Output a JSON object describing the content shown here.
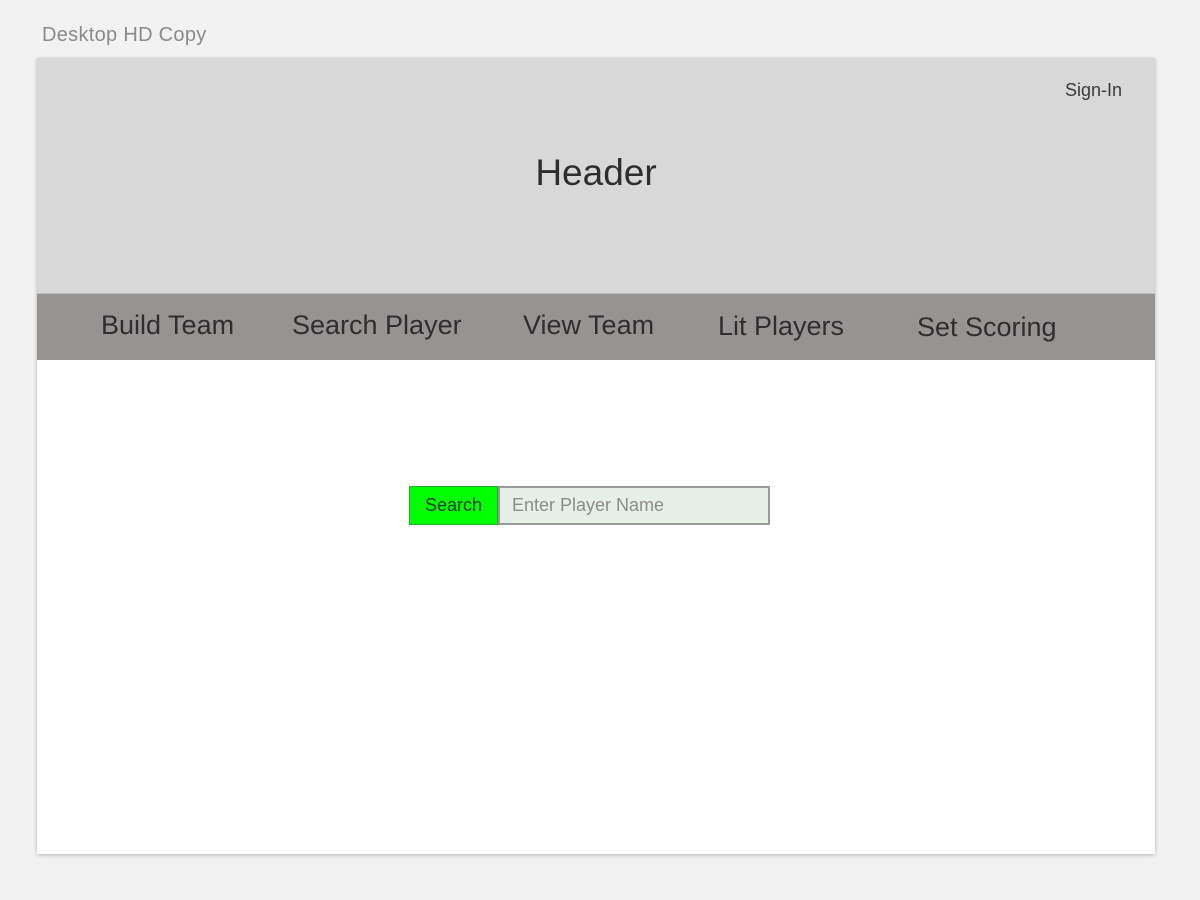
{
  "artboard": {
    "label": "Desktop HD Copy"
  },
  "header": {
    "sign_in_label": "Sign-In",
    "title": "Header"
  },
  "nav": {
    "items": [
      {
        "label": "Build Team"
      },
      {
        "label": "Search Player"
      },
      {
        "label": "View Team"
      },
      {
        "label": "Lit Players"
      },
      {
        "label": "Set Scoring"
      }
    ]
  },
  "search": {
    "button_label": "Search",
    "value": "",
    "placeholder": "Enter Player Name"
  },
  "colors": {
    "background": "#f2f2f2",
    "header_bg": "#d8d8d8",
    "nav_bg": "#979392",
    "search_button_bg": "#00ff00",
    "search_input_bg": "#e6efe8"
  }
}
